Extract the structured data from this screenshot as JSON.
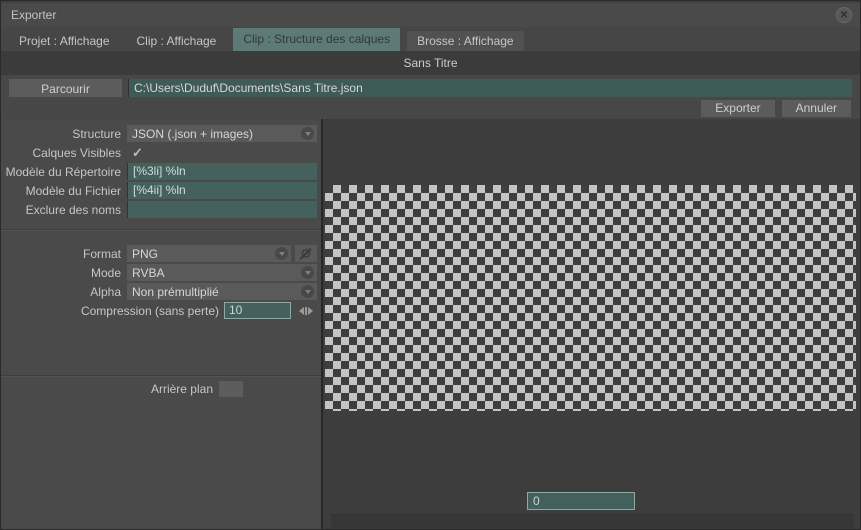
{
  "window": {
    "title": "Exporter"
  },
  "tabs": [
    {
      "label": "Projet : Affichage",
      "selected": false
    },
    {
      "label": "Clip : Affichage",
      "selected": false
    },
    {
      "label": "Clip : Structure des calques",
      "selected": true
    },
    {
      "label": "Brosse : Affichage",
      "selected": false
    }
  ],
  "document_title": "Sans Titre",
  "browse": {
    "button_label": "Parcourir",
    "path": "C:\\Users\\Duduf\\Documents\\Sans Titre.json"
  },
  "actions": {
    "export_label": "Exporter",
    "cancel_label": "Annuler"
  },
  "form": {
    "structure": {
      "label": "Structure",
      "value": "JSON (.json + images)"
    },
    "visible_layers": {
      "label": "Calques Visibles",
      "checked": true,
      "check_glyph": "✓"
    },
    "folder_template": {
      "label": "Modèle du Répertoire",
      "value": "[%3li] %ln"
    },
    "file_template": {
      "label": "Modèle du Fichier",
      "value": "[%4ii] %ln"
    },
    "exclude_names": {
      "label": "Exclure des noms",
      "value": ""
    },
    "format": {
      "label": "Format",
      "value": "PNG"
    },
    "mode": {
      "label": "Mode",
      "value": "RVBA"
    },
    "alpha": {
      "label": "Alpha",
      "value": "Non prémultiplié"
    },
    "compression": {
      "label": "Compression (sans perte)",
      "value": "10"
    },
    "background": {
      "label": "Arrière plan"
    }
  },
  "preview": {
    "frame_value": "0"
  },
  "icons": {
    "close": "close-icon",
    "chevron": "chevron-down-icon",
    "gear": "gear-icon",
    "gear_glyph": "⚙",
    "stepper": "left-right-stepper-icon",
    "close_glyph": "✕"
  },
  "colors": {
    "window_bg": "#474747",
    "left_panel_bg": "#4a4a4a",
    "right_panel_bg": "#3d3d3d",
    "selected_tab": "#5e7a76",
    "field_teal": "#45615e",
    "field_border_teal": "#90a8a5",
    "checker_light": "#c4c4c4",
    "checker_dark": "#3d3d3d"
  }
}
